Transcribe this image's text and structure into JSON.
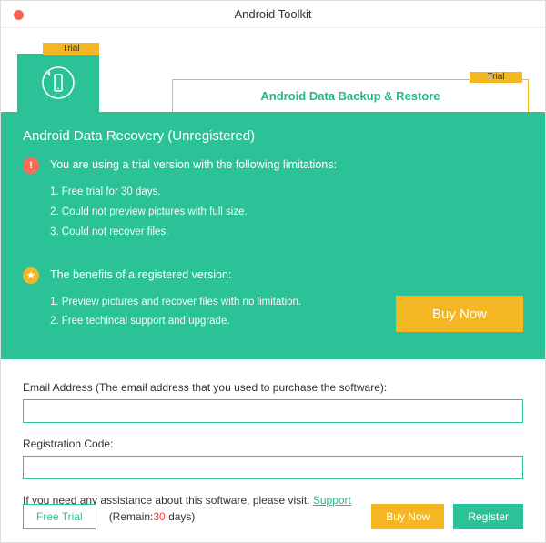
{
  "titlebar": {
    "title": "Android Toolkit"
  },
  "tabs": {
    "left_trial": "Trial",
    "right_trial": "Trial",
    "right_label": "Android Data Backup & Restore"
  },
  "panel": {
    "title": "Android Data Recovery (Unregistered)",
    "warn_text": "You are using a trial version with the following limitations:",
    "warn_items": {
      "i1": "1. Free trial for 30 days.",
      "i2": "2. Could not preview pictures with full size.",
      "i3": "3. Could not recover files."
    },
    "star_text": "The benefits of a registered version:",
    "star_items": {
      "i1": "1. Preview pictures and recover files with no limitation.",
      "i2": "2. Free techincal support and upgrade."
    },
    "buy_now": "Buy Now"
  },
  "form": {
    "email_label": "Email Address (The email address that you used to purchase the software):",
    "code_label": "Registration Code:",
    "support_text": "If you need any assistance about this software, please visit: ",
    "support_link": "Support"
  },
  "footer": {
    "free_trial": "Free Trial",
    "remain_prefix": "(Remain:",
    "remain_days": "30",
    "remain_suffix": " days)",
    "buy_now": "Buy Now",
    "register": "Register"
  }
}
